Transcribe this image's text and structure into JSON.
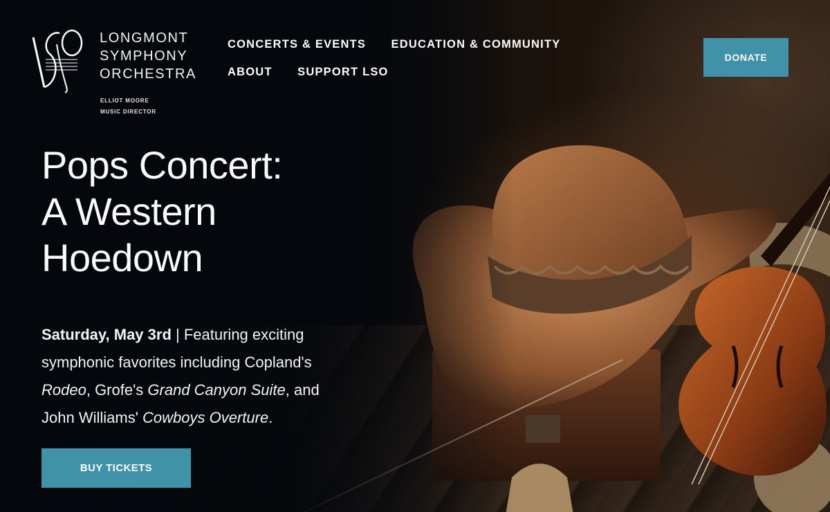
{
  "logo": {
    "monogram": "LSO",
    "name_lines": [
      "LONGMONT",
      "SYMPHONY",
      "ORCHESTRA"
    ],
    "sub_lines": [
      "ELLIOT MOORE",
      "MUSIC DIRECTOR"
    ]
  },
  "nav": {
    "items": [
      {
        "label": "CONCERTS & EVENTS"
      },
      {
        "label": "EDUCATION & COMMUNITY"
      },
      {
        "label": "ABOUT"
      },
      {
        "label": "SUPPORT LSO"
      }
    ]
  },
  "donate_label": "DONATE",
  "hero": {
    "title_lines": [
      "Pops Concert:",
      "A Western",
      "Hoedown"
    ],
    "date": "Saturday, May 3rd",
    "sep": " | ",
    "desc_1": "Featuring exciting symphonic favorites including Copland's ",
    "work_1": "Rodeo",
    "desc_2": ", Grofe's ",
    "work_2": "Grand Canyon Suite",
    "desc_3": ", and John Williams' ",
    "work_3": "Cowboys Overture",
    "desc_4": ".",
    "cta_label": "BUY TICKETS",
    "image_subject": "cowboy hat, violin and rope on wooden floor"
  },
  "colors": {
    "accent": "#3f92a8",
    "background": "#05080d",
    "text": "#ffffff"
  }
}
